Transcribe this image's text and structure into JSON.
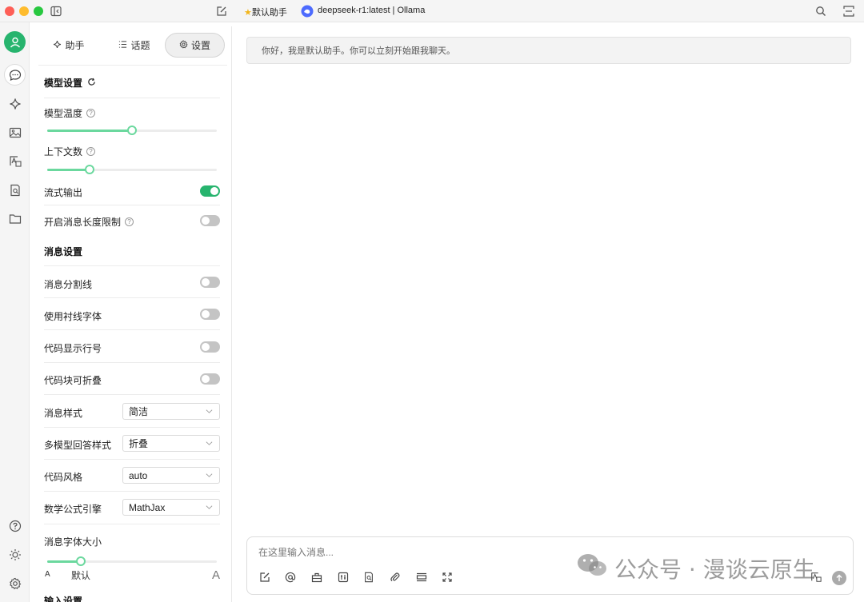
{
  "titlebar": {
    "assistant_name": "默认助手",
    "model_label": "deepseek-r1:latest | Ollama"
  },
  "tabs": [
    {
      "label": "助手",
      "icon": "sparkle-icon"
    },
    {
      "label": "话题",
      "icon": "list-icon"
    },
    {
      "label": "设置",
      "icon": "gear-icon",
      "active": true
    }
  ],
  "model_settings": {
    "title": "模型设置",
    "temperature_label": "模型温度",
    "temperature_value": 0.5,
    "context_label": "上下文数",
    "context_value": 0.25,
    "stream_label": "流式输出",
    "stream_on": true,
    "max_length_label": "开启消息长度限制",
    "max_length_on": false
  },
  "message_settings": {
    "title": "消息设置",
    "divider_label": "消息分割线",
    "serif_label": "使用衬线字体",
    "line_numbers_label": "代码显示行号",
    "collapsible_label": "代码块可折叠",
    "style_label": "消息样式",
    "style_value": "简洁",
    "multi_model_label": "多模型回答样式",
    "multi_model_value": "折叠",
    "code_style_label": "代码风格",
    "code_style_value": "auto",
    "math_label": "数学公式引擎",
    "math_value": "MathJax",
    "font_size_label": "消息字体大小",
    "font_size_value": 0.2,
    "font_small": "A",
    "font_default": "默认",
    "font_large": "A"
  },
  "input_settings": {
    "title": "输入设置"
  },
  "chat": {
    "greeting": "你好，我是默认助手。你可以立刻开始跟我聊天。",
    "input_placeholder": "在这里输入消息..."
  },
  "watermark": {
    "text": "公众号 · 漫谈云原生"
  },
  "colors": {
    "accent": "#27b46e",
    "slider": "#6bd89e"
  }
}
